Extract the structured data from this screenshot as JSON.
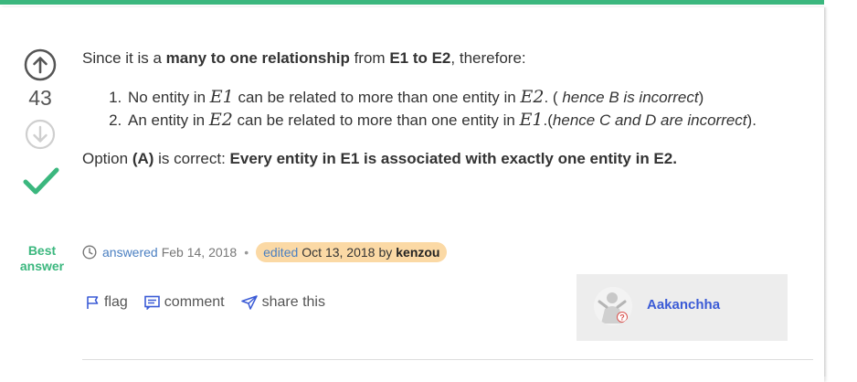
{
  "theme": {
    "accent": "#3bb77e",
    "link": "#4a7fc1",
    "edited_bg": "#fbd9a5",
    "user_link": "#3b5bd6"
  },
  "vote": {
    "count": "43",
    "up_icon": "arrow-up-circle-icon",
    "down_icon": "arrow-down-circle-icon",
    "best_icon": "checkmark-icon"
  },
  "best_answer": {
    "line1": "Best",
    "line2": "answer"
  },
  "answer": {
    "intro_pre": "Since it is a ",
    "intro_bold1": "many to one relationship",
    "intro_mid": " from ",
    "intro_bold2": "E1 to E2",
    "intro_post": ", therefore:",
    "items": [
      {
        "pre": "No entity in ",
        "m1": "E1",
        "mid": " can be related to more than one entity in ",
        "m2": "E2",
        "post": ". ( ",
        "italic": "hence B is incorrect",
        "end": ")"
      },
      {
        "pre": "An entity in ",
        "m1": "E2",
        "mid": " can be related to more than one entity in ",
        "m2": "E1",
        "post": ".(",
        "italic": "hence C and D are incorrect",
        "end": ")."
      }
    ],
    "concl_pre": "Option ",
    "concl_bold1": "(A)",
    "concl_mid": " is correct: ",
    "concl_bold2": "Every entity in E1 is associated with exactly one entity in E2."
  },
  "meta": {
    "answered_label": "answered",
    "answered_date": "Feb 14, 2018",
    "separator": "•",
    "edited_label": "edited",
    "edited_date": "Oct 13, 2018",
    "edited_by": "by",
    "edited_user": "kenzou"
  },
  "actions": {
    "flag": "flag",
    "comment": "comment",
    "share": "share this"
  },
  "user": {
    "name": "Aakanchha",
    "avatar_icon": "user-avatar-icon"
  }
}
